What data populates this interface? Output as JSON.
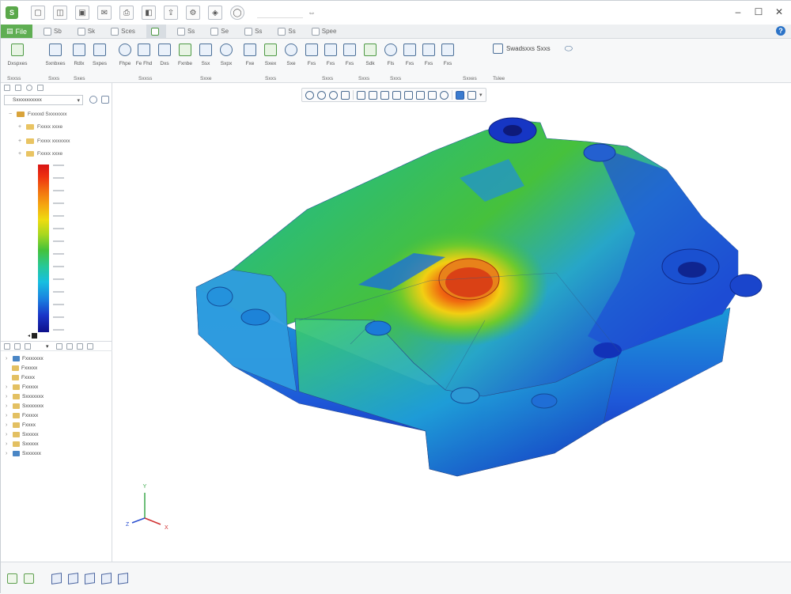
{
  "titlebar": {
    "app_icon_letter": "S",
    "title_text": "",
    "quick_access": [
      "new-icon",
      "open-icon",
      "save-icon",
      "mail-icon",
      "print-icon",
      "pdf-icon",
      "export-icon",
      "settings-icon",
      "cube-icon",
      "circle-icon"
    ],
    "minimize": "–",
    "maximize": "☐",
    "close": "✕"
  },
  "tabs": {
    "file_label": "File",
    "items": [
      {
        "label": "Sb"
      },
      {
        "label": "Sk"
      },
      {
        "label": "Sces"
      },
      {
        "label": ""
      },
      {
        "label": "Ss"
      },
      {
        "label": "Se"
      },
      {
        "label": "Ss"
      },
      {
        "label": "Ss"
      },
      {
        "label": "Spee"
      }
    ],
    "help_glyph": "?"
  },
  "ribbon": {
    "buttons": [
      {
        "label": "Dxspxes"
      },
      {
        "label": "Sxnbxes"
      },
      {
        "label": "Rdlx"
      },
      {
        "label": "Sxpes"
      },
      {
        "label": "Fhpe"
      },
      {
        "label": "Fe Fhd"
      },
      {
        "label": "Dxs"
      },
      {
        "label": "Fxnbe"
      },
      {
        "label": "Ssx"
      },
      {
        "label": "Sxpx"
      },
      {
        "label": "Fxe"
      },
      {
        "label": "Sxex"
      },
      {
        "label": "Sxe"
      },
      {
        "label": "Fxs"
      },
      {
        "label": "Fxs"
      },
      {
        "label": "Fxs"
      },
      {
        "label": "Sdk"
      },
      {
        "label": "Fls"
      },
      {
        "label": "Fxs"
      },
      {
        "label": "Fxs"
      },
      {
        "label": "Fxs"
      }
    ],
    "groups": [
      "Sxxss",
      "Sxxs",
      "Sxes",
      "Sxxss",
      "Sxxe",
      "Sxxs",
      "Sxxs",
      "Sxxs",
      "Sxxs",
      "Sxxes",
      "Tslee"
    ],
    "wide_label": "Swadsxxs Sxxs"
  },
  "left_panel": {
    "dropdown_text": "Sxxxxxxxxxx",
    "tree": [
      {
        "label": "Fxxxxd Sxxxxxxx"
      },
      {
        "label": "Fxxxx xxxe"
      },
      {
        "label": "Fxxxx xxxxxxx"
      },
      {
        "label": "Fxxxx xxxe"
      }
    ],
    "bottom_tree": [
      {
        "label": "Fxxxxxxx"
      },
      {
        "label": "Fxxxxx"
      },
      {
        "label": "Fxxxx"
      },
      {
        "label": "Fxxxxx"
      },
      {
        "label": "Sxxxxxxx"
      },
      {
        "label": "Sxxxxxxx"
      },
      {
        "label": "Fxxxxx"
      },
      {
        "label": "Fxxxx"
      },
      {
        "label": "Sxxxxx"
      },
      {
        "label": "Sxxxxx"
      },
      {
        "label": "Sxxxxxx"
      }
    ]
  },
  "legend": {
    "colors": [
      "#d81515",
      "#f26c10",
      "#eedc10",
      "#45c23a",
      "#17bfe0",
      "#1a35c8",
      "#0d0f8a"
    ]
  },
  "viewport": {
    "toolbar_icons": [
      "zoom-fit-icon",
      "zoom-in-icon",
      "zoom-out-icon",
      "rotate-icon",
      "pan-icon",
      "fit-all-icon",
      "section-icon",
      "measure-icon",
      "iso-icon",
      "front-icon",
      "top-icon",
      "right-icon",
      "view-cube-icon",
      "display-mode-icon"
    ],
    "axis": {
      "y": "Y",
      "z": "Z",
      "x": "X"
    }
  },
  "statusbar": {
    "icons": [
      "select-icon",
      "filter-icon",
      "view-front-icon",
      "view-top-icon",
      "view-right-icon",
      "view-iso-icon",
      "view-back-icon"
    ]
  }
}
